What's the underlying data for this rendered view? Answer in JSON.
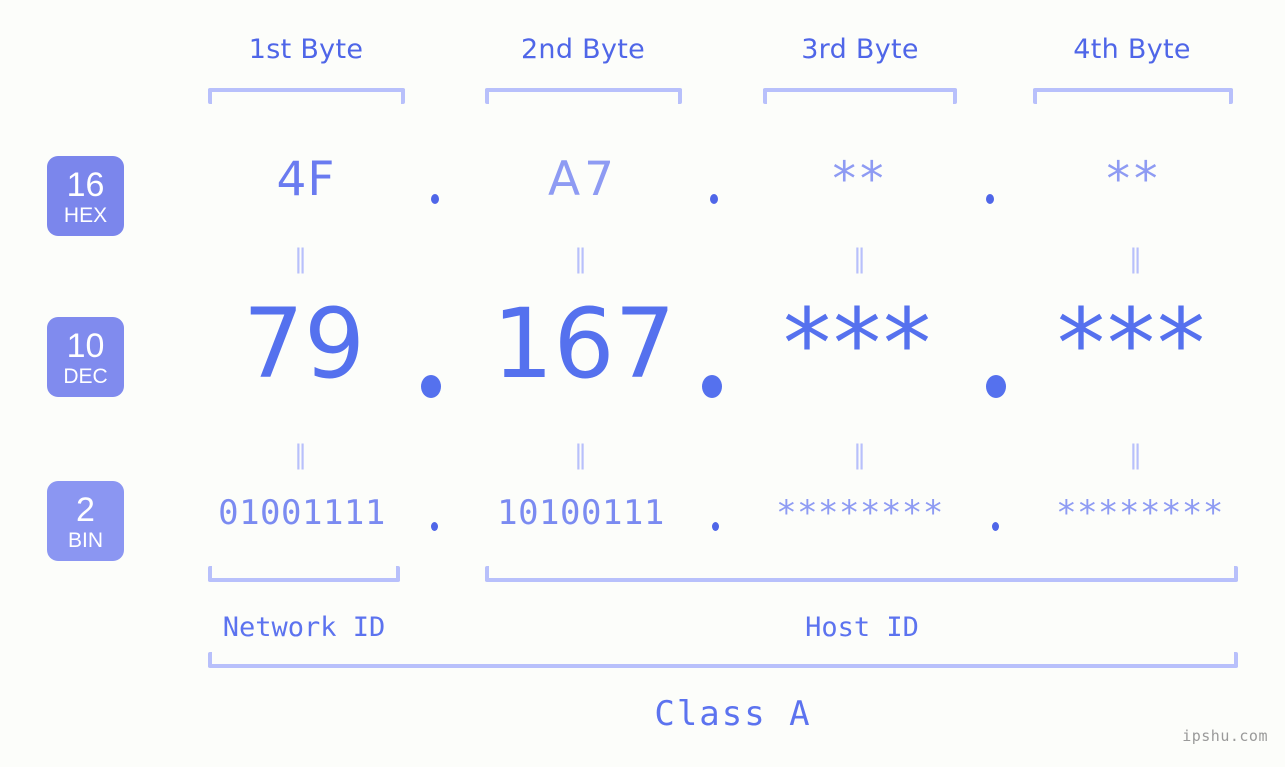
{
  "background_color": "#fcfdfa",
  "accent_color": "#5c73ef",
  "bracket_color": "#b8c0fb",
  "badge_color": "#7b86ec",
  "columns": [
    {
      "header": "1st Byte"
    },
    {
      "header": "2nd Byte"
    },
    {
      "header": "3rd Byte"
    },
    {
      "header": "4th Byte"
    }
  ],
  "rows": {
    "hex": {
      "badge_number": "16",
      "badge_name": "HEX",
      "values": [
        "4F",
        "A7",
        "**",
        "**"
      ]
    },
    "dec": {
      "badge_number": "10",
      "badge_name": "DEC",
      "values": [
        "79",
        "167",
        "***",
        "***"
      ]
    },
    "bin": {
      "badge_number": "2",
      "badge_name": "BIN",
      "values": [
        "01001111",
        "10100111",
        "********",
        "********"
      ]
    }
  },
  "separators": {
    "dot": ".",
    "equals": "‖"
  },
  "footer": {
    "network_id_label": "Network ID",
    "host_id_label": "Host ID",
    "class_label": "Class A"
  },
  "watermark": "ipshu.com"
}
